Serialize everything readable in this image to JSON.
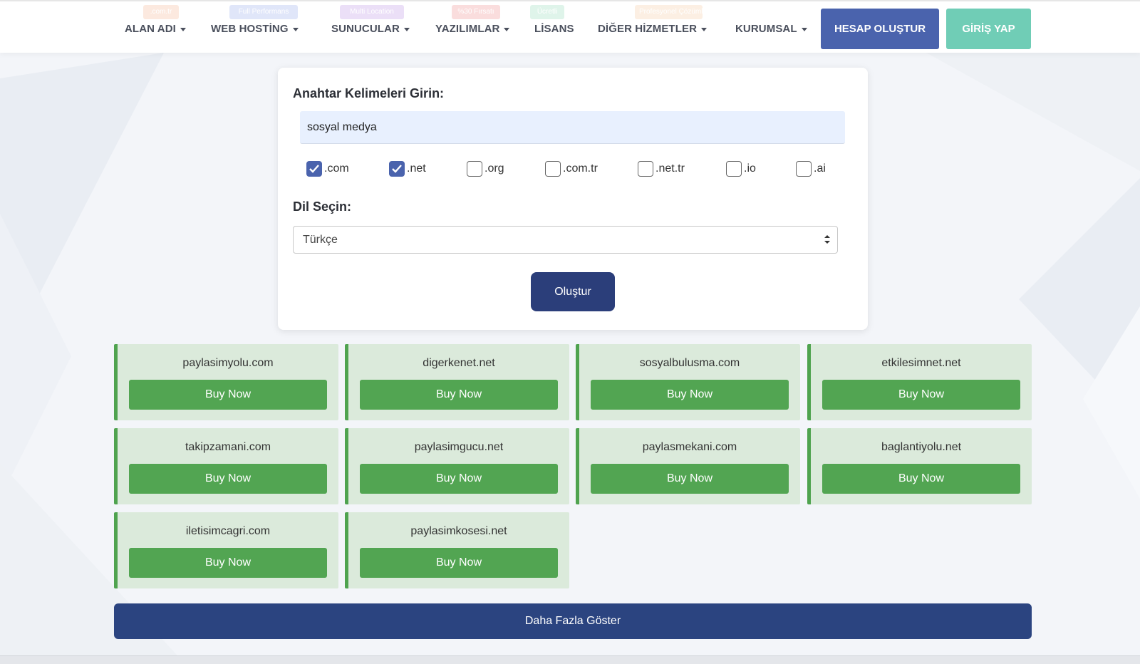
{
  "nav": {
    "items": [
      {
        "label": "ALAN ADI",
        "badge": ".com.tr",
        "badge_color": "#f7c2a6"
      },
      {
        "label": "WEB HOSTİNG",
        "badge": "Full Performans",
        "badge_color": "#a9b9f0"
      },
      {
        "label": "SUNUCULAR",
        "badge": "Multi Location",
        "badge_color": "#c7a6ea"
      },
      {
        "label": "YAZILIMLAR",
        "badge": "%30 Fırsatı",
        "badge_color": "#f2a0a0"
      },
      {
        "label": "LİSANS",
        "badge": "Ücretli",
        "badge_color": "#a6e0c4"
      },
      {
        "label": "DİĞER HİZMETLER",
        "badge": "Profesyonel Çözümler",
        "badge_color": "#f7d3b0"
      },
      {
        "label": "KURUMSAL",
        "badge": "",
        "badge_color": ""
      }
    ],
    "register_label": "HESAP OLUŞTUR",
    "login_label": "GİRİŞ YAP"
  },
  "form": {
    "keywords_label": "Anahtar Kelimeleri Girin:",
    "keyword_value": "sosyal medya",
    "tlds": [
      {
        "label": ".com",
        "checked": true
      },
      {
        "label": ".net",
        "checked": true
      },
      {
        "label": ".org",
        "checked": false
      },
      {
        "label": ".com.tr",
        "checked": false
      },
      {
        "label": ".net.tr",
        "checked": false
      },
      {
        "label": ".io",
        "checked": false
      },
      {
        "label": ".ai",
        "checked": false
      }
    ],
    "language_label": "Dil Seçin:",
    "language_value": "Türkçe",
    "generate_label": "Oluştur"
  },
  "results": {
    "buy_label": "Buy Now",
    "domains": [
      "paylasimyolu.com",
      "digerkenet.net",
      "sosyalbulusma.com",
      "etkilesimnet.net",
      "takipzamani.com",
      "paylasimgucu.net",
      "paylasmekani.com",
      "baglantiyolu.net",
      "iletisimcagri.com",
      "paylasimkosesi.net"
    ],
    "more_label": "Daha Fazla Göster"
  },
  "colors": {
    "primary": "#4a63ad",
    "accent": "#70cdb6",
    "dark_blue": "#2b3e7a",
    "green": "#52a552",
    "card_green": "#dbeadb"
  }
}
